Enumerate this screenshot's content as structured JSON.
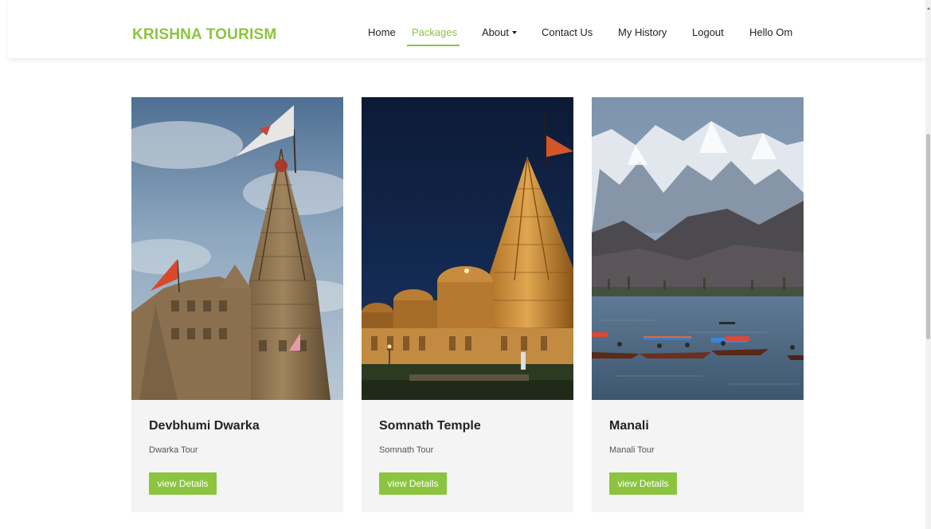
{
  "brand": {
    "name": "KRISHNA TOURISM",
    "color": "#8cc43f"
  },
  "nav": {
    "home": "Home",
    "packages": "Packages",
    "about": "About",
    "contact": "Contact Us",
    "history": "My History",
    "logout": "Logout",
    "greeting": "Hello Om",
    "active": "Packages"
  },
  "cards": [
    {
      "title": "Devbhumi Dwarka",
      "subtitle": "Dwarka Tour",
      "button": "view Details",
      "image": "dwarka-temple-photo"
    },
    {
      "title": "Somnath Temple",
      "subtitle": "Somnath Tour",
      "button": "view Details",
      "image": "somnath-temple-night-photo"
    },
    {
      "title": "Manali",
      "subtitle": "Manali Tour",
      "button": "view Details",
      "image": "mountain-lake-boats-photo"
    }
  ],
  "colors": {
    "accent": "#8cc43f",
    "card_bg": "#f4f4f4",
    "text": "#222222"
  }
}
